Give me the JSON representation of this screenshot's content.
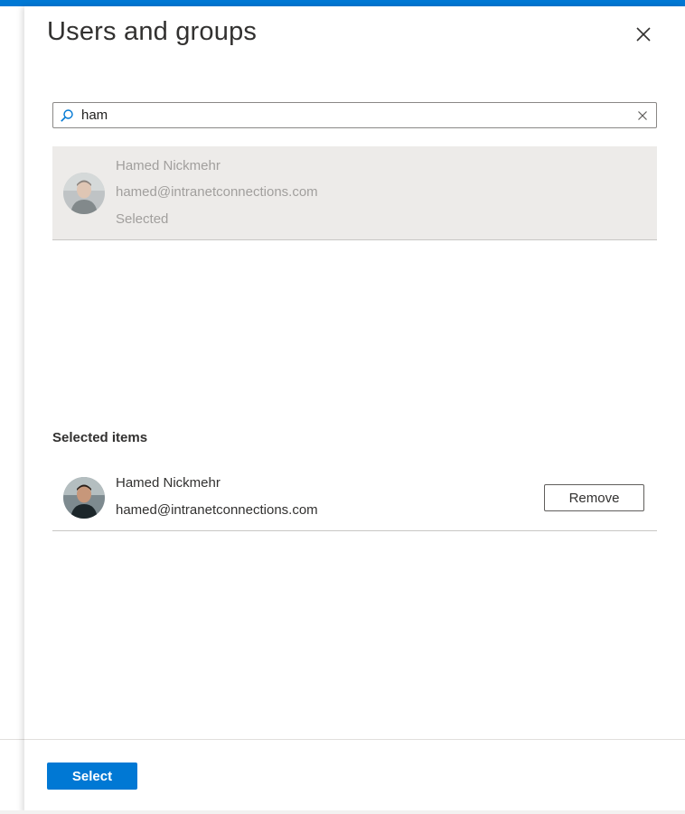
{
  "panel": {
    "title": "Users and groups",
    "close_icon": "close-icon"
  },
  "search": {
    "value": "ham",
    "placeholder": "",
    "search_icon": "search-icon",
    "clear_icon": "clear-icon"
  },
  "results": [
    {
      "name": "Hamed Nickmehr",
      "email": "hamed@intranetconnections.com",
      "status": "Selected"
    }
  ],
  "selected_section": {
    "title": "Selected items",
    "items": [
      {
        "name": "Hamed Nickmehr",
        "email": "hamed@intranetconnections.com",
        "remove_label": "Remove"
      }
    ]
  },
  "footer": {
    "select_label": "Select"
  },
  "colors": {
    "accent": "#0078d4",
    "selected_row_bg": "#edebe9",
    "disabled_text": "#a19f9d"
  }
}
